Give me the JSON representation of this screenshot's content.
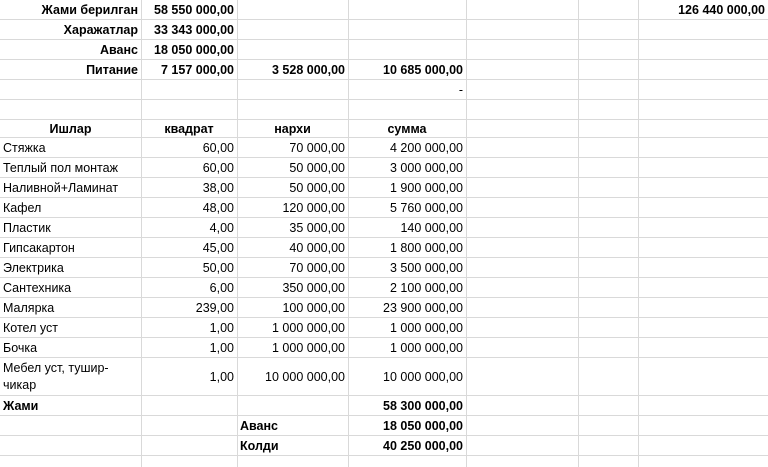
{
  "top": {
    "rows": [
      {
        "label": "Жами берилган",
        "a": "58 550 000,00",
        "b": "",
        "c": "",
        "extra": "126 440 000,00"
      },
      {
        "label": "Харажатлар",
        "a": "33 343 000,00",
        "b": "",
        "c": "",
        "extra": ""
      },
      {
        "label": "Аванс",
        "a": "18 050 000,00",
        "b": "",
        "c": "",
        "extra": ""
      },
      {
        "label": "Питание",
        "a": "7 157 000,00",
        "b": "3 528 000,00",
        "c": "10 685 000,00",
        "extra": ""
      }
    ],
    "dash": "-"
  },
  "headers": {
    "work": "Ишлар",
    "qty": "квадрат",
    "price": "нархи",
    "sum": "сумма"
  },
  "items": [
    {
      "name": "Стяжка",
      "qty": "60,00",
      "price": "70 000,00",
      "sum": "4 200 000,00"
    },
    {
      "name": "Теплый пол монтаж",
      "qty": "60,00",
      "price": "50 000,00",
      "sum": "3 000 000,00"
    },
    {
      "name": "Наливной+Ламинат",
      "qty": "38,00",
      "price": "50 000,00",
      "sum": "1 900 000,00"
    },
    {
      "name": "Кафел",
      "qty": "48,00",
      "price": "120 000,00",
      "sum": "5 760 000,00"
    },
    {
      "name": "Пластик",
      "qty": "4,00",
      "price": "35 000,00",
      "sum": "140 000,00"
    },
    {
      "name": "Гипсакартон",
      "qty": "45,00",
      "price": "40 000,00",
      "sum": "1 800 000,00"
    },
    {
      "name": "Электрика",
      "qty": "50,00",
      "price": "70 000,00",
      "sum": "3 500 000,00"
    },
    {
      "name": "Сантехника",
      "qty": "6,00",
      "price": "350 000,00",
      "sum": "2 100 000,00"
    },
    {
      "name": "Малярка",
      "qty": "239,00",
      "price": "100 000,00",
      "sum": "23 900 000,00"
    },
    {
      "name": "Котел уст",
      "qty": "1,00",
      "price": "1 000 000,00",
      "sum": "1 000 000,00"
    },
    {
      "name": "Бочка",
      "qty": "1,00",
      "price": "1 000 000,00",
      "sum": "1 000 000,00"
    },
    {
      "name": "Мебел уст, тушир-чикар",
      "qty": "1,00",
      "price": "10 000 000,00",
      "sum": "10 000 000,00"
    }
  ],
  "totals": {
    "total_label": "Жами",
    "total_value": "58 300 000,00",
    "advance_label": "Аванс",
    "advance_value": "18 050 000,00",
    "remaining_label": "Колди",
    "remaining_value": "40 250 000,00"
  }
}
